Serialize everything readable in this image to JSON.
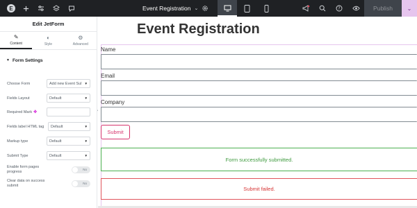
{
  "topbar": {
    "document_title": "Event Registration",
    "publish_label": "Publish",
    "icons": [
      "elementor-logo-icon",
      "plus-icon",
      "sliders-icon",
      "layers-icon",
      "comment-icon",
      "chevron-down-icon",
      "gear-icon",
      "desktop-icon",
      "tablet-icon",
      "mobile-icon",
      "megaphone-icon",
      "search-icon",
      "help-icon",
      "eye-icon",
      "chevron-down-icon"
    ]
  },
  "panel": {
    "title": "Edit JetForm",
    "tabs": [
      {
        "label": "Content",
        "icon": "pencil-icon"
      },
      {
        "label": "Style",
        "icon": "half-circle-icon"
      },
      {
        "label": "Advanced",
        "icon": "gear-icon"
      }
    ],
    "section_title": "Form Settings",
    "fields": {
      "choose_form": {
        "label": "Choose Form",
        "value": "Add new Event Sul"
      },
      "fields_layout": {
        "label": "Fields Layout",
        "value": "Default"
      },
      "required_mark": {
        "label": "Required Mark",
        "value": ""
      },
      "label_html_tag": {
        "label": "Fields label HTML tag",
        "value": "Default"
      },
      "markup_type": {
        "label": "Markup type",
        "value": "Default"
      },
      "submit_type": {
        "label": "Submit Type",
        "value": "Default"
      },
      "enable_pages_progress": {
        "label1": "Enable form pages",
        "label2": "progress",
        "toggle": "No"
      },
      "clear_data": {
        "label1": "Clear data on success",
        "label2": "submit",
        "toggle": "No"
      }
    }
  },
  "canvas": {
    "page_title": "Event Registration",
    "form": {
      "fields": [
        {
          "label": "Name",
          "value": ""
        },
        {
          "label": "Email",
          "value": ""
        },
        {
          "label": "Company",
          "value": ""
        }
      ],
      "submit_label": "Submit",
      "success_message": "Form successfully submitted.",
      "failure_message": "Submit failed."
    }
  },
  "colors": {
    "topbar_bg": "#1f2124",
    "accent_pink": "#d6336c",
    "success_green": "#3e9a3e",
    "fail_red": "#d63333",
    "form_outline": "#e6c5ee"
  }
}
